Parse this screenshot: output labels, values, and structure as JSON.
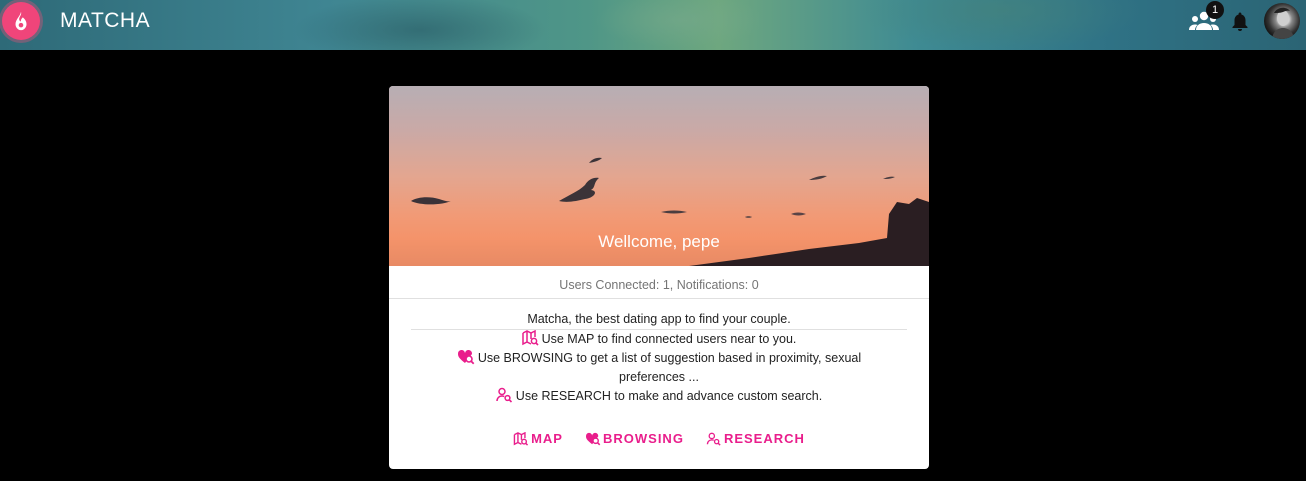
{
  "header": {
    "title": "MATCHA",
    "users_badge": "1",
    "icons": {
      "logo": "flame-icon",
      "users": "group-icon",
      "bell": "bell-icon",
      "avatar": "user-avatar"
    }
  },
  "card": {
    "welcome": "Wellcome, pepe",
    "stats": "Users Connected: 1, Notifications: 0",
    "tagline": "Matcha, the best dating app to find your couple.",
    "lines": {
      "map": "Use MAP to find connected users near to you.",
      "browsing_1": "Use BROWSING to get a list of suggestion based in proximity, sexual",
      "browsing_2": "preferences ...",
      "research": "Use RESEARCH to make and advance custom search."
    },
    "actions": {
      "map": "MAP",
      "browsing": "BROWSING",
      "research": "RESEARCH"
    }
  },
  "colors": {
    "accent": "#e91e8c",
    "logo": "#f0457a",
    "background": "#000000"
  }
}
